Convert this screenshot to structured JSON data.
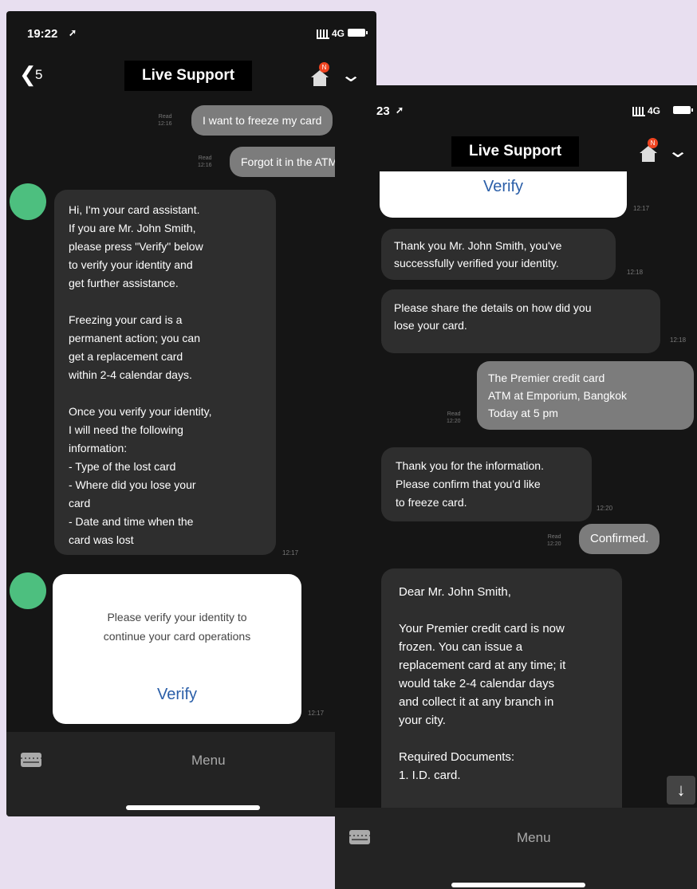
{
  "left": {
    "status": {
      "time": "19:22",
      "network": "4G"
    },
    "header": {
      "back_count": "5",
      "title": "Live Support",
      "badge": "N"
    },
    "messages": {
      "out1": {
        "text": "I want to freeze my card",
        "read": "Read",
        "time": "12:16"
      },
      "out2": {
        "text": "Forgot it in the ATM",
        "read": "Read",
        "time": "12:16"
      },
      "in1": {
        "text": "Hi, I'm your card assistant.\nIf you are Mr. John Smith,\nplease press \"Verify\" below\nto verify your identity and\nget further assistance.\n\nFreezing your card is a\npermanent action; you can\nget a replacement card\nwithin 2-4 calendar days.\n\nOnce you verify your identity,\nI will need the following\ninformation:\n- Type of the lost card\n- Where did you lose your\ncard\n- Date and time when the\ncard was lost",
        "time": "12:17"
      },
      "card": {
        "text": "Please verify your identity to\ncontinue your card operations",
        "button": "Verify",
        "time": "12:17"
      }
    },
    "bottom": {
      "menu": "Menu"
    }
  },
  "right": {
    "status": {
      "time": "23",
      "network": "4G"
    },
    "header": {
      "title": "Live Support",
      "badge": "N"
    },
    "messages": {
      "verify_card": {
        "button": "Verify",
        "time": "12:17"
      },
      "in1": {
        "text": "Thank you Mr. John Smith, you've\nsuccessfully verified your identity.",
        "time": "12:18"
      },
      "in2": {
        "text": "Please share the details on how did you\nlose your card.",
        "time": "12:18"
      },
      "out1": {
        "text": "The Premier credit card\nATM at Emporium, Bangkok\nToday at 5 pm",
        "read": "Read",
        "time": "12:20"
      },
      "in3": {
        "text": "Thank you for the information.\nPlease confirm that you'd like\nto freeze card.",
        "time": "12:20"
      },
      "out2": {
        "text": "Confirmed.",
        "read": "Read",
        "time": "12:20"
      },
      "in4": {
        "text": "Dear Mr. John Smith,\n\nYour Premier credit card is now\nfrozen. You can issue a\nreplacement card at any time; it\nwould take 2-4 calendar days\nand collect it at any branch in\nyour city.\n\nRequired Documents:\n1. I.D. card."
      }
    },
    "bottom": {
      "menu": "Menu"
    }
  },
  "colors": {
    "background": "#e8dff0",
    "avatar": "#4dbf7f",
    "verify": "#2a5ea8",
    "badge": "#f04420"
  }
}
